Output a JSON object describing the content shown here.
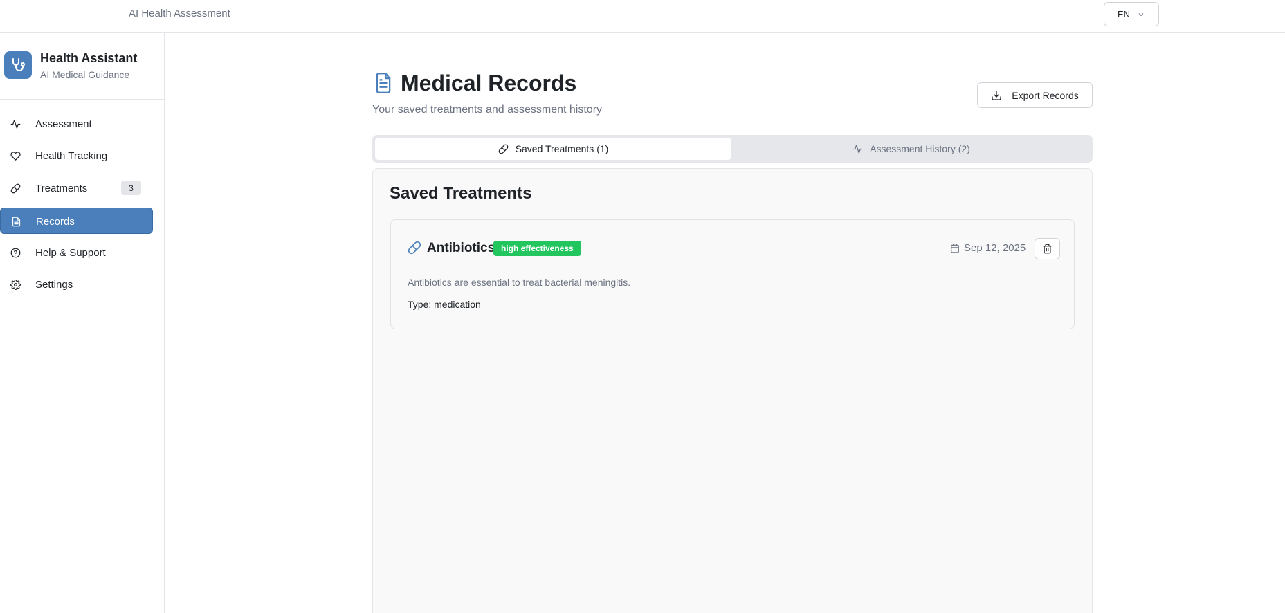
{
  "header": {
    "app_title": "AI Health Assessment",
    "language": "EN"
  },
  "sidebar": {
    "brand_name": "Health Assistant",
    "brand_sub": "AI Medical Guidance",
    "items": [
      {
        "label": "Assessment",
        "icon": "activity-icon"
      },
      {
        "label": "Health Tracking",
        "icon": "heart-icon"
      },
      {
        "label": "Treatments",
        "icon": "pill-icon",
        "badge": "3"
      },
      {
        "label": "Records",
        "icon": "file-text-icon",
        "active": true
      },
      {
        "label": "Help & Support",
        "icon": "help-circle-icon"
      },
      {
        "label": "Settings",
        "icon": "gear-icon"
      }
    ]
  },
  "page": {
    "title": "Medical Records",
    "subtitle": "Your saved treatments and assessment history",
    "export_label": "Export Records"
  },
  "tabs": [
    {
      "label": "Saved Treatments (1)",
      "active": true
    },
    {
      "label": "Assessment History (2)",
      "active": false
    }
  ],
  "panel": {
    "title": "Saved Treatments",
    "treatments": [
      {
        "name": "Antibiotics",
        "badge": "high effectiveness",
        "date": "Sep 12, 2025",
        "description": "Antibiotics are essential to treat bacterial meningitis.",
        "type_line": "Type: medication"
      }
    ]
  },
  "colors": {
    "primary": "#4a7fbb",
    "badge_green": "#22c55e",
    "muted_text": "#6b7280"
  }
}
